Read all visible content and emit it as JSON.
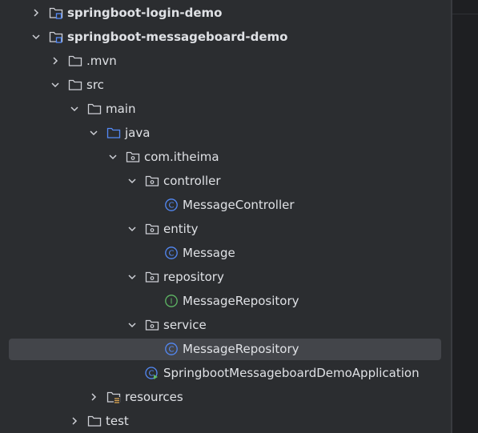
{
  "tree": [
    {
      "label": "springboot-login-demo",
      "icon": "module-folder-icon",
      "depth": 0,
      "arrow": "collapsed",
      "bold": true
    },
    {
      "label": "springboot-messageboard-demo",
      "icon": "module-folder-icon",
      "depth": 0,
      "arrow": "expanded",
      "bold": true
    },
    {
      "label": ".mvn",
      "icon": "folder-icon",
      "depth": 1,
      "arrow": "collapsed"
    },
    {
      "label": "src",
      "icon": "folder-icon",
      "depth": 1,
      "arrow": "expanded"
    },
    {
      "label": "main",
      "icon": "folder-icon",
      "depth": 2,
      "arrow": "expanded"
    },
    {
      "label": "java",
      "icon": "source-folder-icon",
      "depth": 3,
      "arrow": "expanded"
    },
    {
      "label": "com.itheima",
      "icon": "package-icon",
      "depth": 4,
      "arrow": "expanded"
    },
    {
      "label": "controller",
      "icon": "package-icon",
      "depth": 5,
      "arrow": "expanded"
    },
    {
      "label": "MessageController",
      "icon": "class-icon",
      "depth": 6,
      "arrow": "none"
    },
    {
      "label": "entity",
      "icon": "package-icon",
      "depth": 5,
      "arrow": "expanded"
    },
    {
      "label": "Message",
      "icon": "class-icon",
      "depth": 6,
      "arrow": "none"
    },
    {
      "label": "repository",
      "icon": "package-icon",
      "depth": 5,
      "arrow": "expanded"
    },
    {
      "label": "MessageRepository",
      "icon": "interface-icon",
      "depth": 6,
      "arrow": "none"
    },
    {
      "label": "service",
      "icon": "package-icon",
      "depth": 5,
      "arrow": "expanded"
    },
    {
      "label": "MessageRepository",
      "icon": "class-icon",
      "depth": 6,
      "arrow": "none",
      "selected": true
    },
    {
      "label": "SpringbootMessageboardDemoApplication",
      "icon": "spring-boot-app-icon",
      "depth": 5,
      "arrow": "none"
    },
    {
      "label": "resources",
      "icon": "resources-folder-icon",
      "depth": 3,
      "arrow": "collapsed"
    },
    {
      "label": "test",
      "icon": "folder-icon",
      "depth": 2,
      "arrow": "collapsed"
    }
  ],
  "colors": {
    "background": "#2b2d30",
    "selection": "#43454a",
    "text": "#dfe1e5",
    "folder_stroke": "#ced0d6",
    "source_folder": "#548af7",
    "class_icon": "#548af7",
    "interface_icon": "#5fb865"
  }
}
